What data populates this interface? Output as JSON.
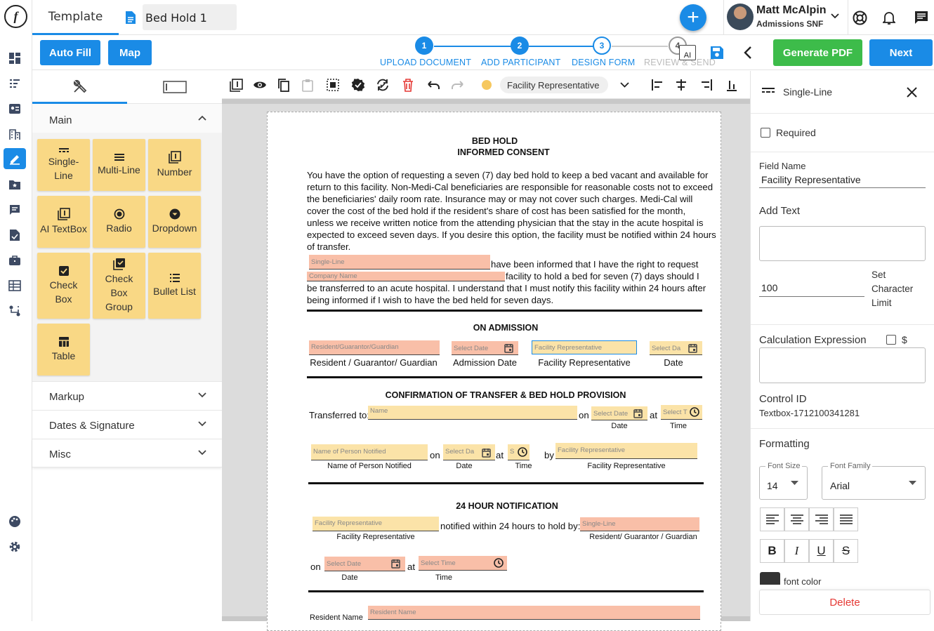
{
  "header": {
    "tab_label": "Template",
    "document_name": "Bed Hold 1",
    "add_label": "+",
    "user": {
      "name": "Matt McAlpin",
      "role": "Admissions SNF"
    }
  },
  "toolbar": {
    "auto_fill": "Auto Fill",
    "map": "Map",
    "generate_pdf": "Generate PDF",
    "next": "Next",
    "steps": [
      {
        "num": "1",
        "label": "UPLOAD DOCUMENT"
      },
      {
        "num": "2",
        "label": "ADD PARTICIPANT"
      },
      {
        "num": "3",
        "label": "DESIGN FORM"
      },
      {
        "num": "4",
        "label": "REVIEW & SEND"
      }
    ],
    "ai_badge": "AI"
  },
  "left_panel": {
    "main_section": "Main",
    "fields": [
      {
        "label": "Single-\nLine",
        "icon": "single-line-icon"
      },
      {
        "label": "Multi-Line",
        "icon": "multi-line-icon"
      },
      {
        "label": "Number",
        "icon": "number-icon"
      },
      {
        "label": "AI TextBox",
        "icon": "ai-textbox-icon"
      },
      {
        "label": "Radio",
        "icon": "radio-icon"
      },
      {
        "label": "Dropdown",
        "icon": "dropdown-icon"
      },
      {
        "label": "Check\nBox",
        "icon": "checkbox-icon"
      },
      {
        "label": "Check\nBox\nGroup",
        "icon": "checkbox-group-icon"
      },
      {
        "label": "Bullet List",
        "icon": "bullet-list-icon"
      },
      {
        "label": "Table",
        "icon": "table-icon"
      }
    ],
    "sections": [
      "Markup",
      "Dates & Signature",
      "Misc"
    ]
  },
  "doc_toolbar": {
    "participant": "Facility Representative"
  },
  "document": {
    "title1": "BED HOLD",
    "title2": "INFORMED CONSENT",
    "para1": [
      "You have the option of requesting a seven (7) day bed hold to keep a bed vacant and available for",
      "return to this facility. Non-Medi-Cal beneficiaries are responsible for reasonable costs not to exceed",
      "the beneficiaries' daily room rate. Insurance may or may not cover such charges. Medi-Cal will",
      "cover the cost of the bed hold if the resident's share of cost has been satisfied for the month,",
      "unless we receive written notice from the attending physician that the stay in the acute hospital is",
      "expected to exceed seven days. If you desire this option, the facility must be notified within 24 hours",
      "of transfer."
    ],
    "para2_line1": "have been informed that I have the right to request",
    "para2_line2": "facility to hold a bed for seven (7) days should I",
    "para2_line3": "be transferred to an acute hospital. I understand that I must notify this facility within 24 hours after",
    "para2_line4": "being informed if I wish to have the bed held for seven days.",
    "sec_admission": "ON ADMISSION",
    "sec_confirmation": "CONFIRMATION OF TRANSFER & BED HOLD PROVISION",
    "sec_24hour": "24 HOUR NOTIFICATION",
    "fields": {
      "single_line": "Single-Line",
      "company_name": "Company Name",
      "resident_guardian": "Resident/Guarantor/Guardian",
      "select_date": "Select Date",
      "select_date_short": "Select Da",
      "select_time": "Select Time",
      "select_time_short": "Select T",
      "facility_rep": "Facility Representative",
      "name": "Name",
      "name_person_notified": "Name of Person Notified",
      "resident_name": "Resident Name",
      "s": "S"
    },
    "captions": {
      "resident_guardian": "Resident / Guarantor/ Guardian",
      "admission_date": "Admission Date",
      "facility_rep": "Facility Representative",
      "date": "Date",
      "transferred_to": "Transferred to:",
      "on": "on",
      "at": "at",
      "time": "Time",
      "by": "by",
      "name_person_notified": "Name of Person Notified",
      "notified_within": "notified within 24 hours to hold by:",
      "resident_guarantor_guardian2": "Resident/ Guarantor / Guardian",
      "resident_name_cap": "Resident Name"
    }
  },
  "right_panel": {
    "type_label": "Single-Line",
    "required": "Required",
    "field_name_label": "Field Name",
    "field_name_value": "Facility Representative",
    "add_text": "Add Text",
    "char_limit_value": "100",
    "char_limit_label": "Set\nCharacter\nLimit",
    "calc_label": "Calculation Expression",
    "calc_dollar": "$",
    "control_id_label": "Control ID",
    "control_id_value": "Textbox-1712100341281",
    "formatting": "Formatting",
    "font_size_label": "Font Size",
    "font_size_value": "14",
    "font_family_label": "Font Family",
    "font_family_value": "Arial",
    "font_color": "font color",
    "delete": "Delete"
  },
  "colors": {
    "accent": "#1a8be6",
    "green": "#3dbc4a",
    "field_yellow": "#f9d885",
    "field_pink": "#f9bfa8",
    "delete": "#e53935"
  }
}
